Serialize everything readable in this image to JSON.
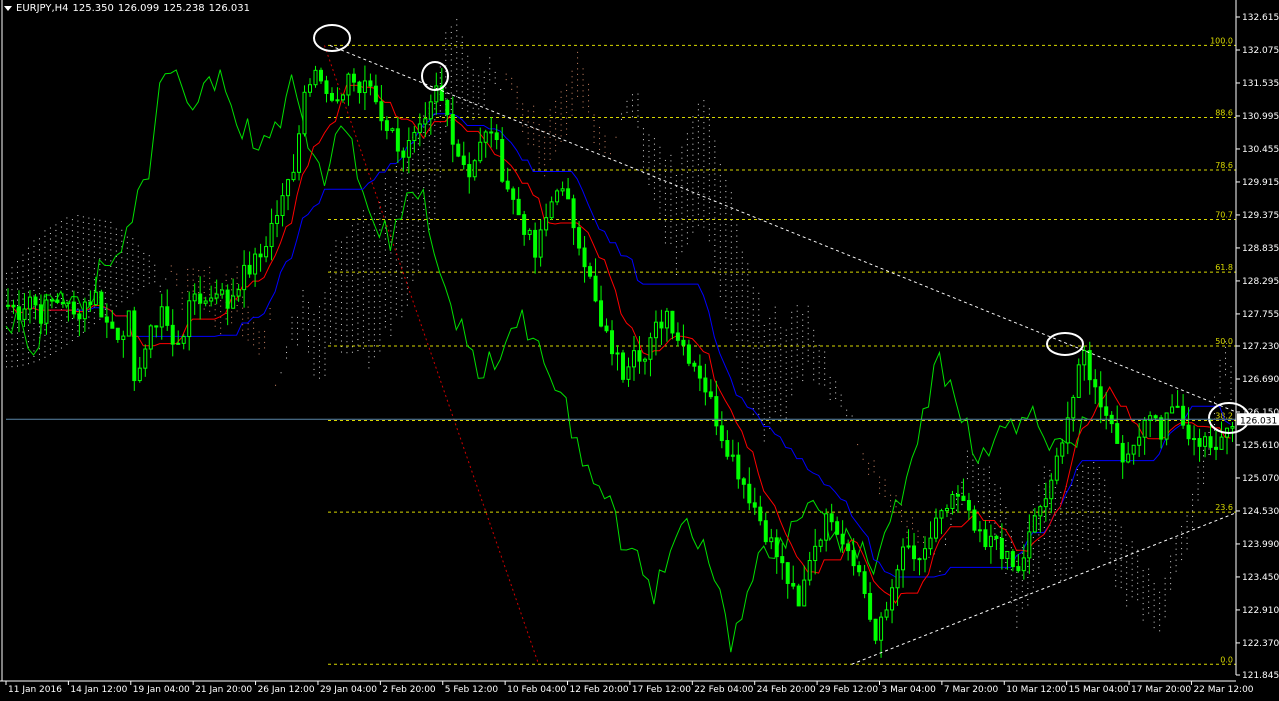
{
  "header": {
    "symbol": "EURJPY,H4",
    "open": "125.350",
    "high": "126.099",
    "low": "125.238",
    "close": "126.031"
  },
  "colors": {
    "background": "#000000",
    "candles": "#00ff00",
    "chikou": "#00e000",
    "tenkan": "#ff0000",
    "kijun": "#0000ff",
    "cloud_bull": "#f4a07a",
    "cloud_bear": "#ffffff",
    "fib": "#d8d800",
    "trendline": "#ffffff",
    "fib_diagonal": "#d00000",
    "price_line": "#5b86a8"
  },
  "chart_data": {
    "type": "line",
    "instrument": "EURJPY",
    "timeframe": "H4",
    "current_price": "126.031",
    "y_ticks": [
      "132.615",
      "132.075",
      "131.535",
      "130.995",
      "130.455",
      "129.915",
      "129.375",
      "128.835",
      "128.295",
      "127.755",
      "127.230",
      "126.690",
      "126.150",
      "125.610",
      "125.070",
      "124.530",
      "123.990",
      "123.450",
      "122.910",
      "122.370",
      "121.845"
    ],
    "ylim": [
      121.845,
      132.615
    ],
    "x_ticks": [
      "11 Jan 2016",
      "14 Jan 12:00",
      "19 Jan 04:00",
      "21 Jan 20:00",
      "26 Jan 12:00",
      "29 Jan 04:00",
      "2 Feb 20:00",
      "5 Feb 12:00",
      "10 Feb 04:00",
      "12 Feb 20:00",
      "17 Feb 12:00",
      "22 Feb 04:00",
      "24 Feb 20:00",
      "29 Feb 12:00",
      "3 Mar 04:00",
      "7 Mar 20:00",
      "10 Mar 12:00",
      "15 Mar 04:00",
      "17 Mar 20:00",
      "22 Mar 12:00"
    ],
    "fibonacci": {
      "high": 132.15,
      "low": 122.02,
      "levels": [
        {
          "label": "100.0",
          "value": 132.15
        },
        {
          "label": "88.6",
          "value": 130.97
        },
        {
          "label": "78.6",
          "value": 130.11
        },
        {
          "label": "70.7",
          "value": 129.3
        },
        {
          "label": "61.8",
          "value": 128.44
        },
        {
          "label": "50.0",
          "value": 127.23
        },
        {
          "label": "38.2",
          "value": 126.01
        },
        {
          "label": "23.6",
          "value": 124.51
        },
        {
          "label": "0.0",
          "value": 122.02
        }
      ]
    },
    "price_path": [
      [
        0,
        127.9
      ],
      [
        2,
        127.8
      ],
      [
        4,
        128.05
      ],
      [
        6,
        127.75
      ],
      [
        8,
        127.95
      ],
      [
        10,
        128.0
      ],
      [
        12,
        127.7
      ],
      [
        14,
        127.95
      ],
      [
        16,
        128.05
      ],
      [
        18,
        127.6
      ],
      [
        20,
        127.45
      ],
      [
        22,
        127.65
      ],
      [
        23,
        126.5
      ],
      [
        24,
        127.0
      ],
      [
        26,
        127.4
      ],
      [
        28,
        127.9
      ],
      [
        30,
        127.2
      ],
      [
        32,
        127.5
      ],
      [
        34,
        128.1
      ],
      [
        36,
        127.95
      ],
      [
        38,
        128.2
      ],
      [
        40,
        127.9
      ],
      [
        42,
        128.3
      ],
      [
        44,
        128.5
      ],
      [
        46,
        128.7
      ],
      [
        48,
        129.2
      ],
      [
        50,
        129.6
      ],
      [
        52,
        130.2
      ],
      [
        54,
        131.4
      ],
      [
        56,
        131.9
      ],
      [
        58,
        131.3
      ],
      [
        60,
        131.1
      ],
      [
        62,
        131.7
      ],
      [
        64,
        131.4
      ],
      [
        66,
        131.5
      ],
      [
        68,
        131.0
      ],
      [
        70,
        130.7
      ],
      [
        72,
        130.4
      ],
      [
        74,
        130.6
      ],
      [
        76,
        130.8
      ],
      [
        78,
        131.4
      ],
      [
        80,
        131.0
      ],
      [
        82,
        130.4
      ],
      [
        84,
        130.1
      ],
      [
        86,
        130.5
      ],
      [
        88,
        130.8
      ],
      [
        90,
        130.1
      ],
      [
        92,
        129.6
      ],
      [
        94,
        129.2
      ],
      [
        96,
        128.7
      ],
      [
        98,
        129.3
      ],
      [
        100,
        129.9
      ],
      [
        102,
        129.5
      ],
      [
        104,
        129.0
      ],
      [
        106,
        128.3
      ],
      [
        108,
        127.5
      ],
      [
        110,
        127.2
      ],
      [
        112,
        126.8
      ],
      [
        114,
        127.3
      ],
      [
        116,
        127.0
      ],
      [
        118,
        127.5
      ],
      [
        120,
        127.8
      ],
      [
        122,
        127.4
      ],
      [
        124,
        127.1
      ],
      [
        126,
        126.8
      ],
      [
        128,
        126.3
      ],
      [
        130,
        125.8
      ],
      [
        132,
        125.4
      ],
      [
        134,
        125.0
      ],
      [
        136,
        124.6
      ],
      [
        138,
        124.2
      ],
      [
        140,
        123.8
      ],
      [
        142,
        123.4
      ],
      [
        144,
        122.9
      ],
      [
        146,
        123.8
      ],
      [
        148,
        124.2
      ],
      [
        150,
        124.5
      ],
      [
        152,
        124.1
      ],
      [
        154,
        123.8
      ],
      [
        156,
        123.2
      ],
      [
        158,
        122.4
      ],
      [
        160,
        122.9
      ],
      [
        162,
        123.7
      ],
      [
        164,
        123.9
      ],
      [
        166,
        123.6
      ],
      [
        168,
        124.1
      ],
      [
        170,
        124.4
      ],
      [
        172,
        124.8
      ],
      [
        174,
        124.6
      ],
      [
        176,
        124.2
      ],
      [
        178,
        123.9
      ],
      [
        180,
        124.1
      ],
      [
        182,
        123.7
      ],
      [
        184,
        123.5
      ],
      [
        186,
        124.1
      ],
      [
        188,
        124.6
      ],
      [
        190,
        124.9
      ],
      [
        192,
        125.8
      ],
      [
        194,
        126.4
      ],
      [
        196,
        127.1
      ],
      [
        198,
        126.5
      ],
      [
        200,
        126.2
      ],
      [
        202,
        125.7
      ],
      [
        204,
        125.3
      ],
      [
        206,
        125.9
      ],
      [
        208,
        126.2
      ],
      [
        210,
        125.8
      ],
      [
        212,
        126.3
      ],
      [
        214,
        125.9
      ],
      [
        216,
        125.6
      ],
      [
        218,
        125.8
      ],
      [
        220,
        125.4
      ],
      [
        222,
        126.03
      ]
    ],
    "annotations": [
      "swing high 1",
      "swing high 2",
      "swing high 3",
      "current price"
    ]
  }
}
